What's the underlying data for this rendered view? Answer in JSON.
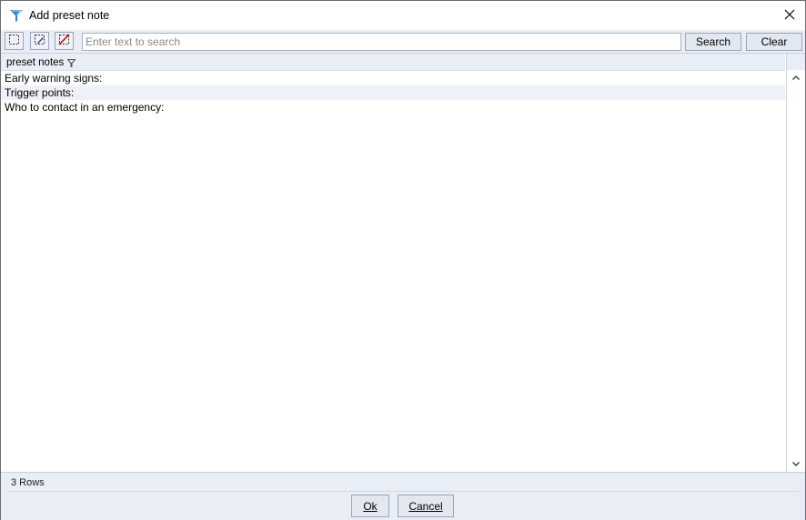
{
  "window": {
    "title": "Add preset note",
    "close_label": "×"
  },
  "toolbar": {
    "search_placeholder": "Enter text to search",
    "search_value": "",
    "search_label": "Search",
    "clear_label": "Clear",
    "tools": [
      {
        "icon": "select-all-icon"
      },
      {
        "icon": "select-edit-icon"
      },
      {
        "icon": "deselect-icon"
      }
    ]
  },
  "grid": {
    "column_header": "preset notes",
    "rows": [
      "Early warning signs:",
      "Trigger points:",
      "Who to contact in an emergency:"
    ]
  },
  "footer": {
    "row_count": "3 Rows",
    "ok_label": "Ok",
    "cancel_label": "Cancel"
  },
  "colors": {
    "accent": "#2a7fd4",
    "toolbar_bg": "#e9edf5",
    "alt_row": "#eef1f7",
    "deselect_red": "#d01818"
  }
}
